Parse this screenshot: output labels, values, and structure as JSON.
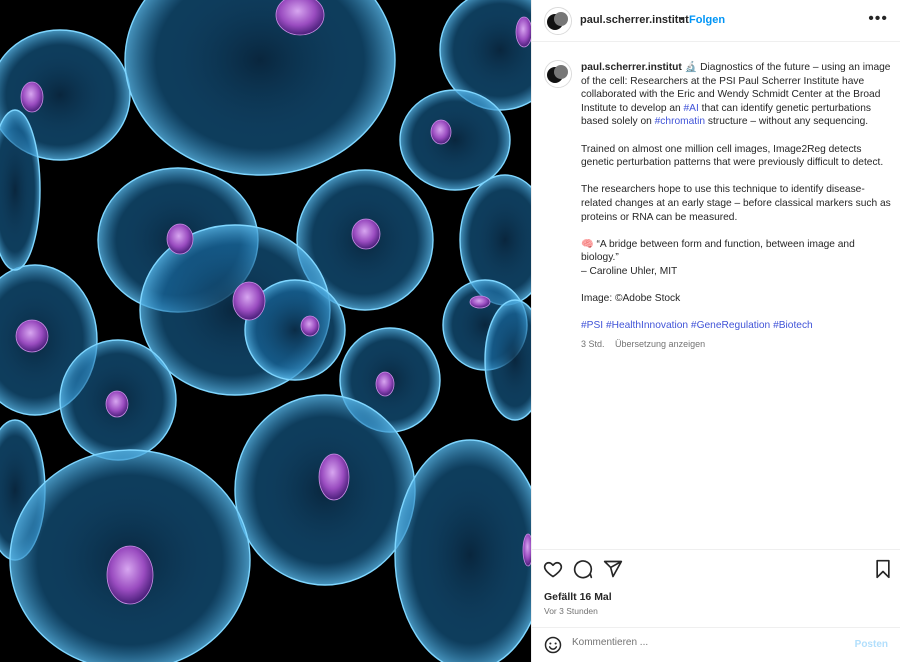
{
  "image": {
    "description_icon": "cell-microscopy-image",
    "background": "#000000",
    "cell_color": "#4fb6ee",
    "nucleus_color": "#a55ec8"
  },
  "header": {
    "username": "paul.scherrer.institut",
    "separator": "•",
    "follow_label": "Folgen",
    "more_icon": "more-horizontal-icon",
    "more_label": "•••"
  },
  "caption": {
    "username": "paul.scherrer.institut",
    "emoji_1": "🔬",
    "p1_a": "Diagnostics of the future – using an image of the cell: Researchers at the PSI Paul Scherrer Institute have collaborated with the Eric and Wendy Schmidt Center at the Broad Institute to develop an ",
    "tag_ai": "#AI",
    "p1_b": " that can identify genetic perturbations based solely on ",
    "tag_chromatin": "#chromatin",
    "p1_c": " structure – without any sequencing.",
    "p2": "Trained on almost one million cell images, Image2Reg detects genetic perturbation patterns that were previously difficult to detect.",
    "p3": "The researchers hope to use this technique to identify disease-related changes at an early stage – before classical markers such as proteins or RNA can be measured.",
    "emoji_2": "🧠",
    "quote": " “A bridge between form and function, between image and biology.”",
    "quote_author": "– Caroline Uhler, MIT",
    "image_credit": "Image: ©Adobe Stock",
    "hashtags": [
      "#PSI",
      "#HealthInnovation",
      "#GeneRegulation",
      "#Biotech"
    ],
    "age": "3 Std.",
    "translate_label": "Übersetzung anzeigen"
  },
  "actions": {
    "like_icon": "heart-icon",
    "comment_icon": "comment-icon",
    "share_icon": "share-icon",
    "save_icon": "bookmark-icon",
    "likes_text": "Gefällt 16 Mal",
    "time_text": "Vor 3 Stunden"
  },
  "comment": {
    "emoji_icon": "smiley-icon",
    "placeholder": "Kommentieren ...",
    "post_label": "Posten"
  },
  "colors": {
    "accent": "#0095f6",
    "link": "#4154d8",
    "muted": "#737373",
    "post_disabled": "#b2dffc"
  }
}
